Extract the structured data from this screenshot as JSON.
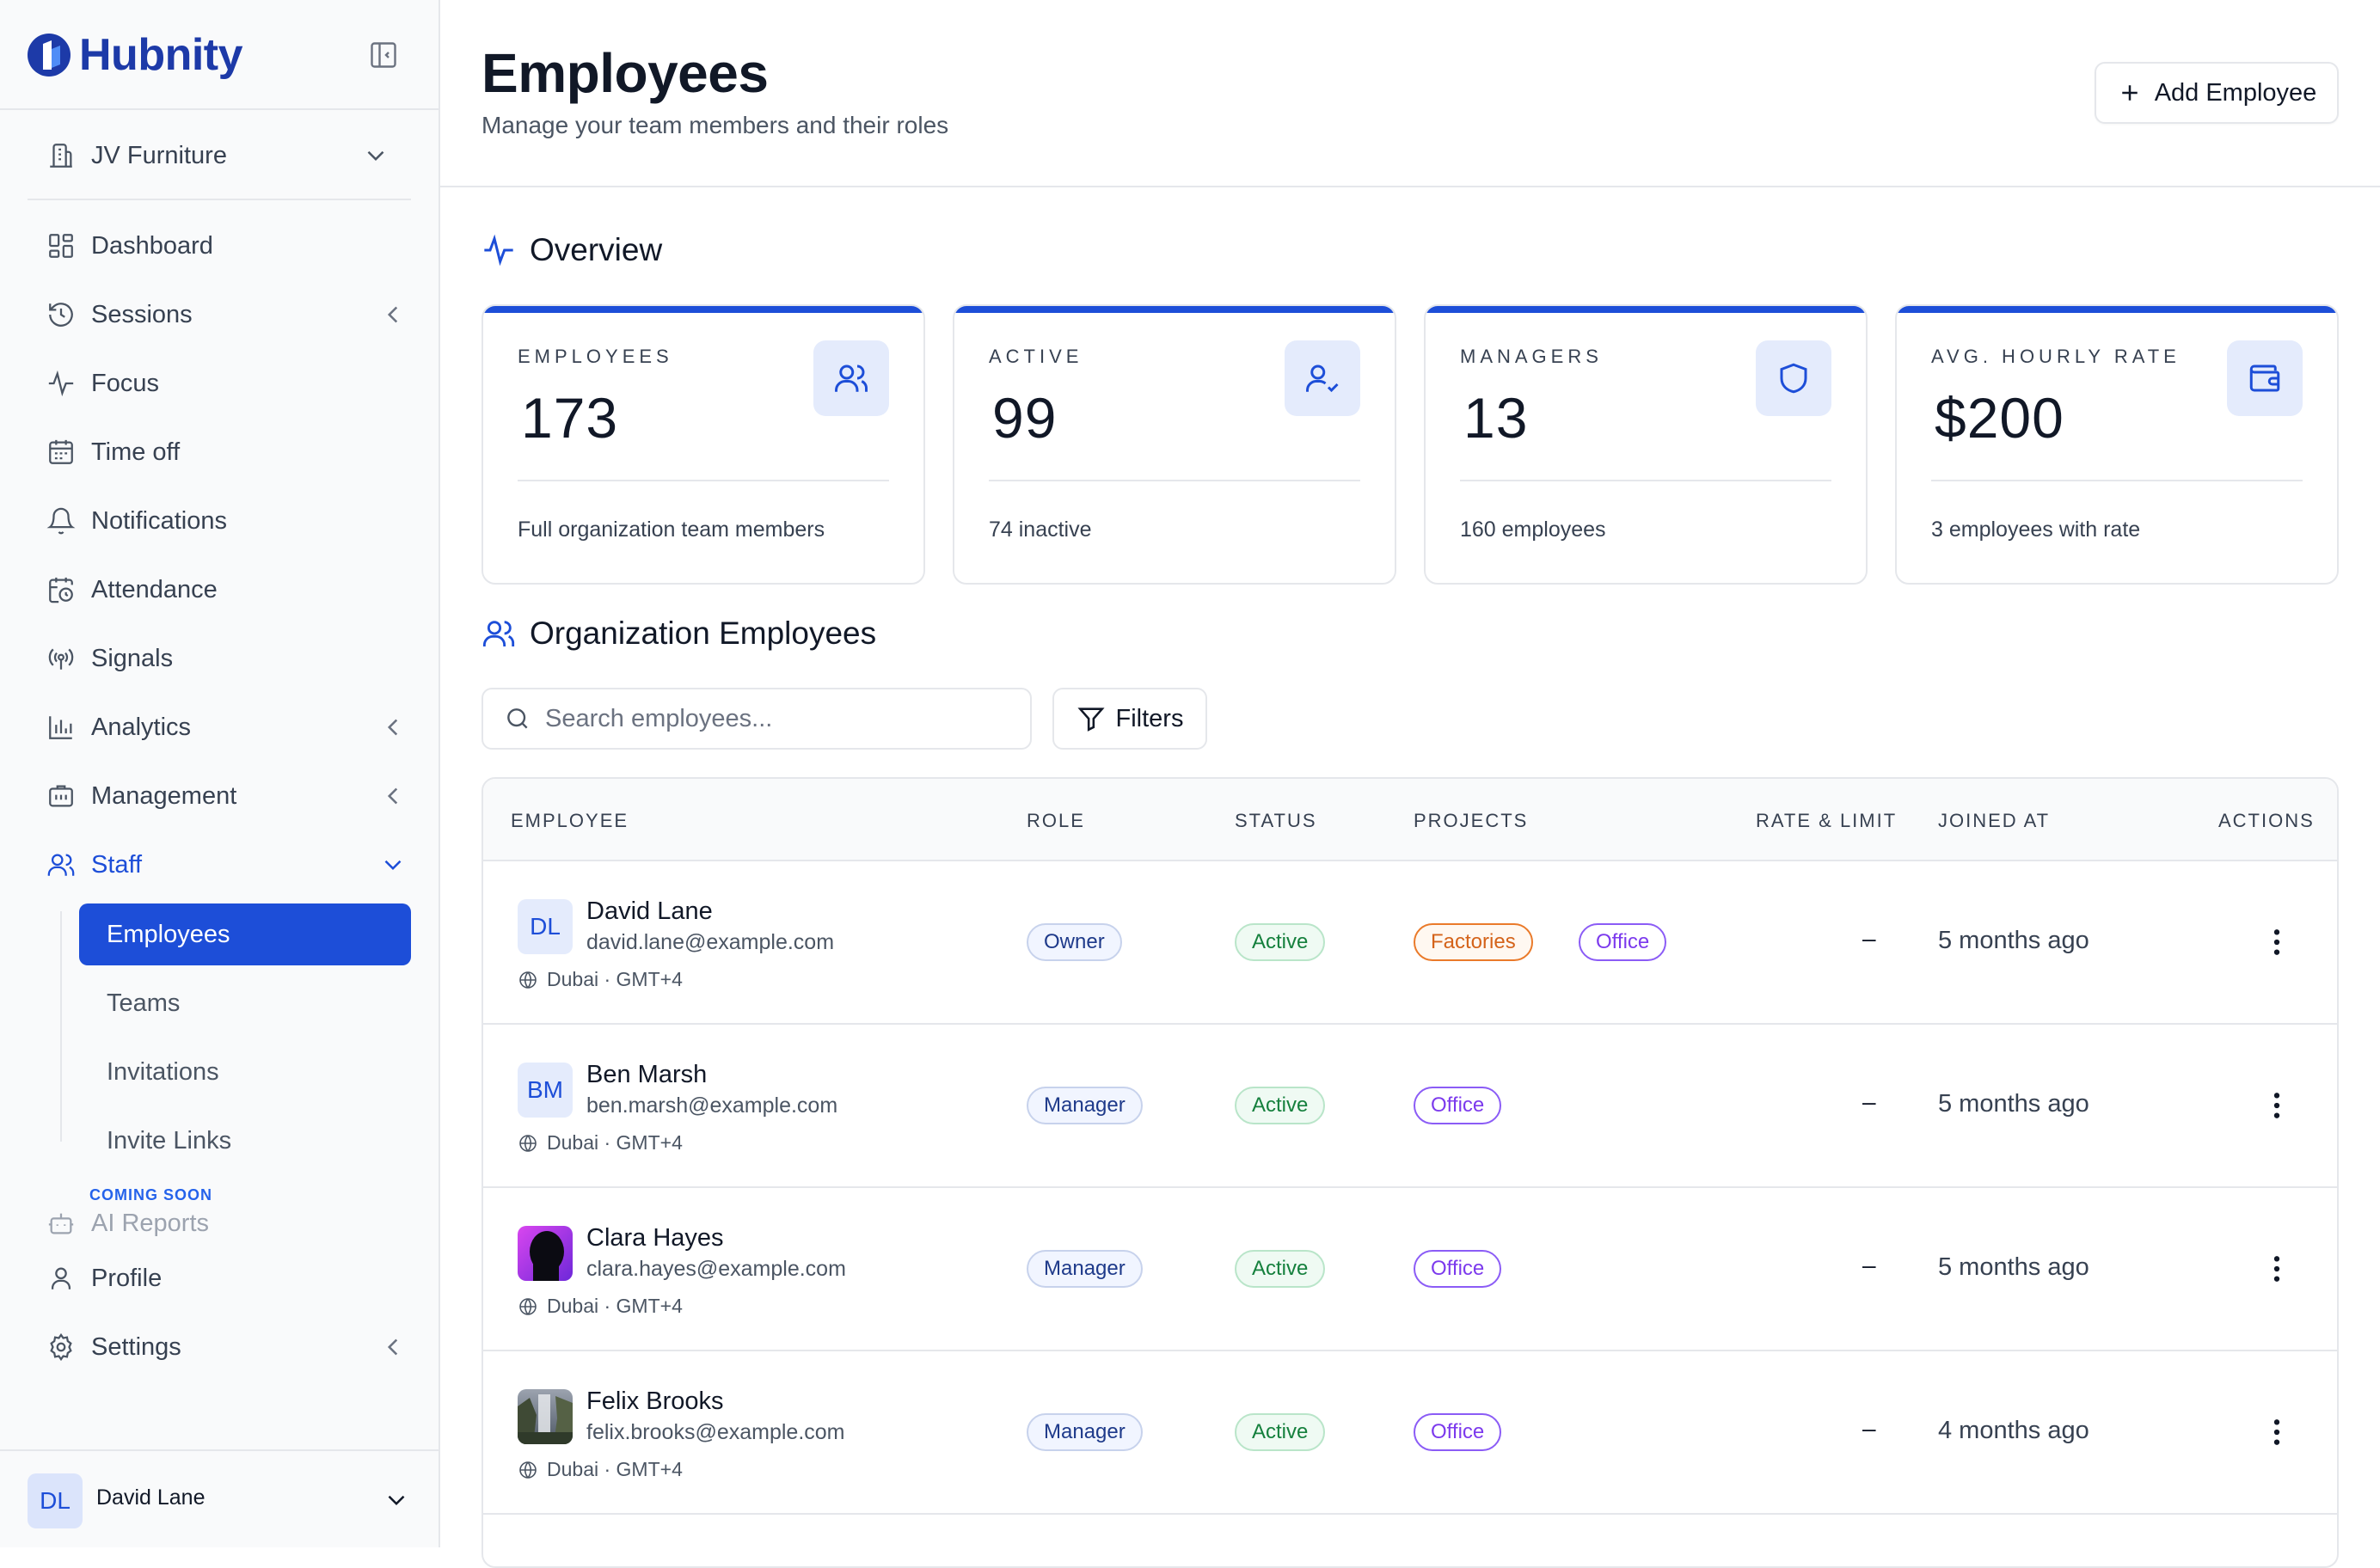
{
  "app": {
    "name": "Hubnity",
    "brand_color": "#1d4ed8"
  },
  "sidebar": {
    "org": "JV Furniture",
    "items": [
      {
        "label": "Dashboard",
        "icon": "dashboard-icon"
      },
      {
        "label": "Sessions",
        "icon": "history-icon"
      },
      {
        "label": "Focus",
        "icon": "activity-icon"
      },
      {
        "label": "Time off",
        "icon": "calendar-icon"
      },
      {
        "label": "Notifications",
        "icon": "bell-icon"
      },
      {
        "label": "Attendance",
        "icon": "calendar-clock-icon"
      },
      {
        "label": "Signals",
        "icon": "radio-icon"
      },
      {
        "label": "Analytics",
        "icon": "bar-chart-icon"
      },
      {
        "label": "Management",
        "icon": "briefcase-icon"
      },
      {
        "label": "Staff",
        "icon": "users-icon"
      }
    ],
    "staff_sub": [
      "Employees",
      "Teams",
      "Invitations",
      "Invite Links"
    ],
    "coming_soon": "COMING SOON",
    "ai_reports": "AI Reports",
    "profile": "Profile",
    "settings": "Settings",
    "user": {
      "initials": "DL",
      "name": "David Lane"
    }
  },
  "header": {
    "title": "Employees",
    "subtitle": "Manage your team members and their roles",
    "add_label": "Add Employee"
  },
  "overview": {
    "title": "Overview",
    "cards": [
      {
        "label": "EMPLOYEES",
        "value": "173",
        "note": "Full organization team members",
        "icon": "users-icon"
      },
      {
        "label": "ACTIVE",
        "value": "99",
        "note": "74 inactive",
        "icon": "user-check-icon"
      },
      {
        "label": "MANAGERS",
        "value": "13",
        "note": "160 employees",
        "icon": "shield-icon"
      },
      {
        "label": "AVG. HOURLY RATE",
        "value": "$200",
        "note": "3 employees with rate",
        "icon": "wallet-icon"
      }
    ]
  },
  "org_employees": {
    "title": "Organization Employees",
    "search_placeholder": "Search employees...",
    "filters_label": "Filters",
    "columns": [
      "EMPLOYEE",
      "ROLE",
      "STATUS",
      "PROJECTS",
      "RATE & LIMIT",
      "JOINED AT",
      "ACTIONS"
    ],
    "rows": [
      {
        "initials": "DL",
        "name": "David Lane",
        "email": "david.lane@example.com",
        "location": "Dubai · GMT+4",
        "role": "Owner",
        "status": "Active",
        "projects": [
          "Factories",
          "Office"
        ],
        "rate": "–",
        "joined": "5 months ago"
      },
      {
        "initials": "BM",
        "name": "Ben Marsh",
        "email": "ben.marsh@example.com",
        "location": "Dubai · GMT+4",
        "role": "Manager",
        "status": "Active",
        "projects": [
          "Office"
        ],
        "rate": "–",
        "joined": "5 months ago"
      },
      {
        "initials": "",
        "name": "Clara Hayes",
        "email": "clara.hayes@example.com",
        "location": "Dubai · GMT+4",
        "role": "Manager",
        "status": "Active",
        "projects": [
          "Office"
        ],
        "rate": "–",
        "joined": "5 months ago"
      },
      {
        "initials": "",
        "name": "Felix Brooks",
        "email": "felix.brooks@example.com",
        "location": "Dubai · GMT+4",
        "role": "Manager",
        "status": "Active",
        "projects": [
          "Office"
        ],
        "rate": "–",
        "joined": "4 months ago"
      }
    ]
  }
}
